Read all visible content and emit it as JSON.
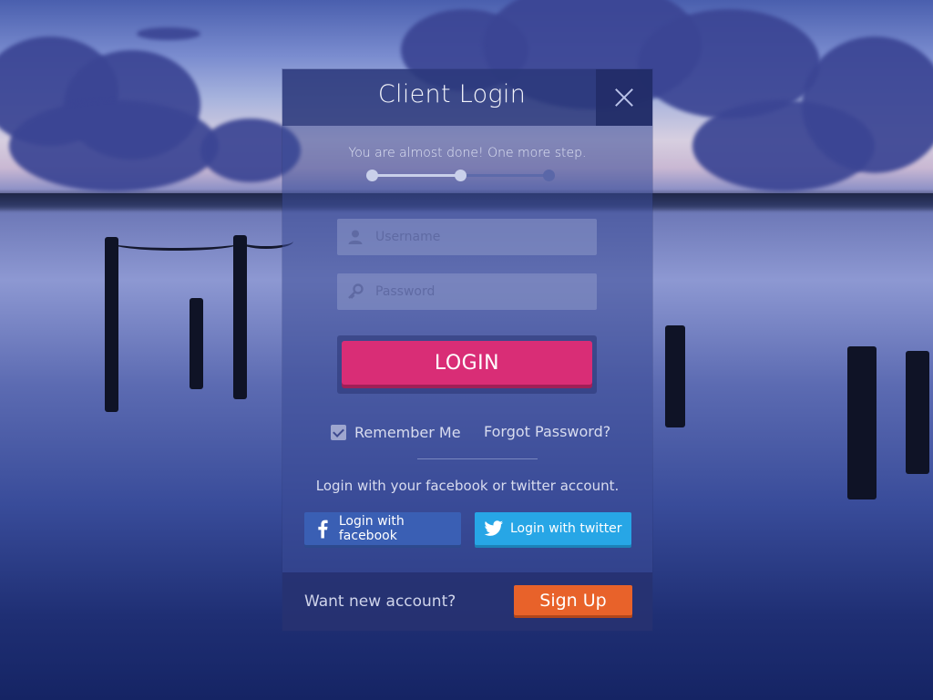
{
  "panel": {
    "title": "Client Login",
    "step_text": "You are almost done! One more step.",
    "progress": {
      "current_step": 2,
      "total_steps": 3
    }
  },
  "form": {
    "username_placeholder": "Username",
    "password_placeholder": "Password",
    "login_label": "LOGIN",
    "remember_label": "Remember Me",
    "remember_checked": true,
    "forgot_label": "Forgot Password?"
  },
  "social": {
    "prompt": "Login with your facebook or twitter account.",
    "facebook_label": "Login with facebook",
    "twitter_label": "Login with twitter"
  },
  "footer": {
    "prompt": "Want new account?",
    "signup_label": "Sign Up"
  },
  "icons": {
    "close": "close-icon",
    "username": "user-icon",
    "password": "key-icon",
    "facebook": "facebook-icon",
    "twitter": "twitter-icon",
    "remember": "checkmark-icon"
  },
  "colors": {
    "login": "#d92d76",
    "facebook": "#3a5fb4",
    "twitter": "#27a6e6",
    "signup": "#e8622a"
  }
}
